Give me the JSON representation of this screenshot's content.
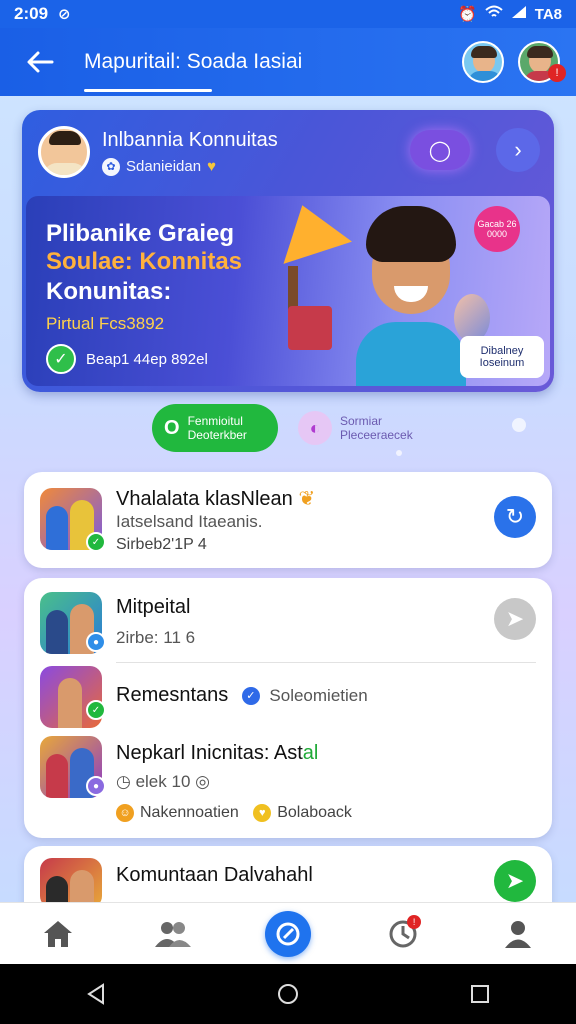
{
  "status_bar": {
    "time": "2:09",
    "battery": "TA8"
  },
  "app_bar": {
    "title": "Mapuritail: Soada Iasiai"
  },
  "hero": {
    "name": "Inlbannia Konnuitas",
    "subtitle": "Sdanieidan",
    "banner": {
      "line1": "Plibanike Graieg",
      "line2": "Soulae: Konnitas",
      "line3": "Konunitas:",
      "points": "Pirtual Fcs3892",
      "check_text": "Beap1 44ep 892el",
      "promo_chip": "Gacab 26 0000",
      "tag_line1": "Dibalney",
      "tag_line2": "Ioseinum"
    }
  },
  "actions": {
    "primary_line1": "Fenmioitul",
    "primary_line2": "Deoterkber",
    "secondary_line1": "Sormiar",
    "secondary_line2": "Pleceeraecek"
  },
  "list": [
    {
      "title": "Vhalalata klasNlean",
      "line2": "Iatselsand Itaeanis.",
      "line3": "Sirbeb2'1P 4"
    },
    {
      "title": "Mitpeital",
      "line2": "2irbe: 11 6"
    },
    {
      "title": "Remesntans",
      "line2": "Soleomietien"
    },
    {
      "title": "Nepkarl Inicnitas: Ast",
      "title_accent": "al",
      "line2": "elek 10",
      "line3a": "Nakennoatien",
      "line3b": "Bolaboack"
    },
    {
      "title": "Komuntaan Dalvahahl"
    }
  ],
  "colors": {
    "primary": "#1b63e8",
    "green": "#21b83e",
    "notification": "#e02424"
  },
  "icons": {
    "back": "arrow-left-icon",
    "home": "home-icon",
    "groups": "people-icon",
    "center": "compose-icon",
    "activity": "clock-icon",
    "profile": "person-icon"
  }
}
